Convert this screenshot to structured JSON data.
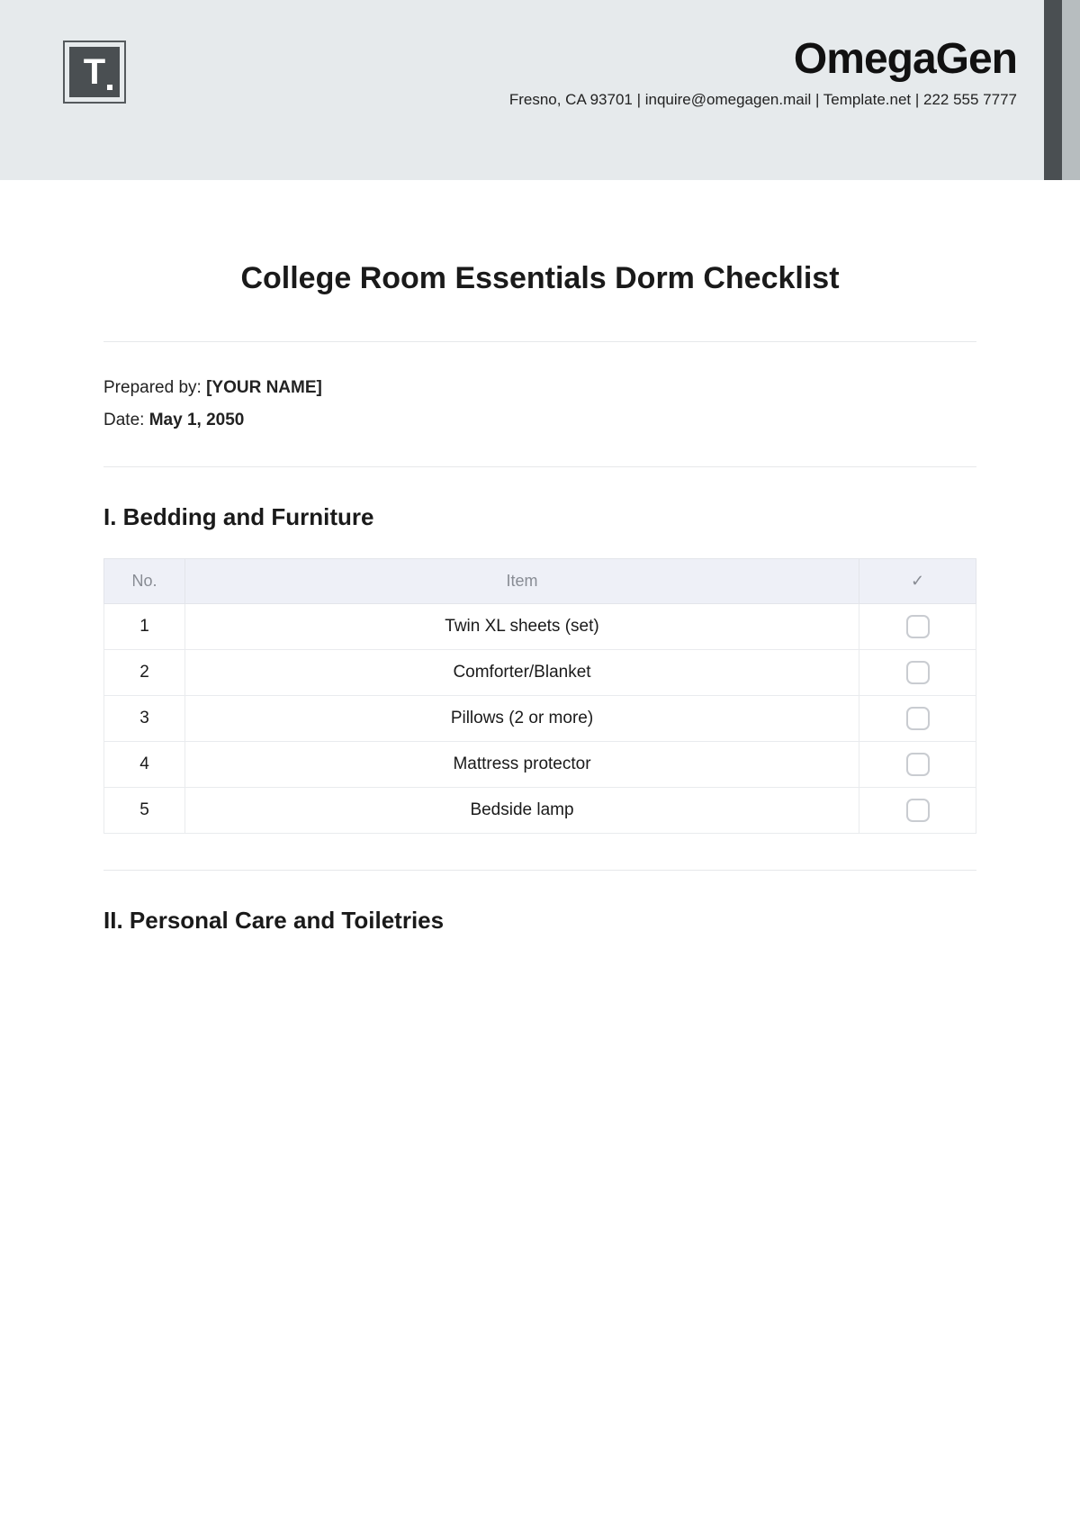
{
  "header": {
    "logo_letter": "T",
    "brand_name": "OmegaGen",
    "brand_info": "Fresno, CA 93701 | inquire@omegagen.mail | Template.net | 222 555 7777"
  },
  "document": {
    "title": "College Room Essentials Dorm Checklist",
    "prepared_by_label": "Prepared by: ",
    "prepared_by_value": "[YOUR NAME]",
    "date_label": "Date: ",
    "date_value": "May 1, 2050"
  },
  "columns": {
    "no": "No.",
    "item": "Item",
    "check": "✓"
  },
  "sections": [
    {
      "title": "I. Bedding and Furniture",
      "rows": [
        {
          "no": "1",
          "item": "Twin XL sheets (set)"
        },
        {
          "no": "2",
          "item": "Comforter/Blanket"
        },
        {
          "no": "3",
          "item": "Pillows (2 or more)"
        },
        {
          "no": "4",
          "item": "Mattress protector"
        },
        {
          "no": "5",
          "item": "Bedside lamp"
        }
      ]
    },
    {
      "title": "II. Personal Care and Toiletries",
      "rows": []
    }
  ]
}
